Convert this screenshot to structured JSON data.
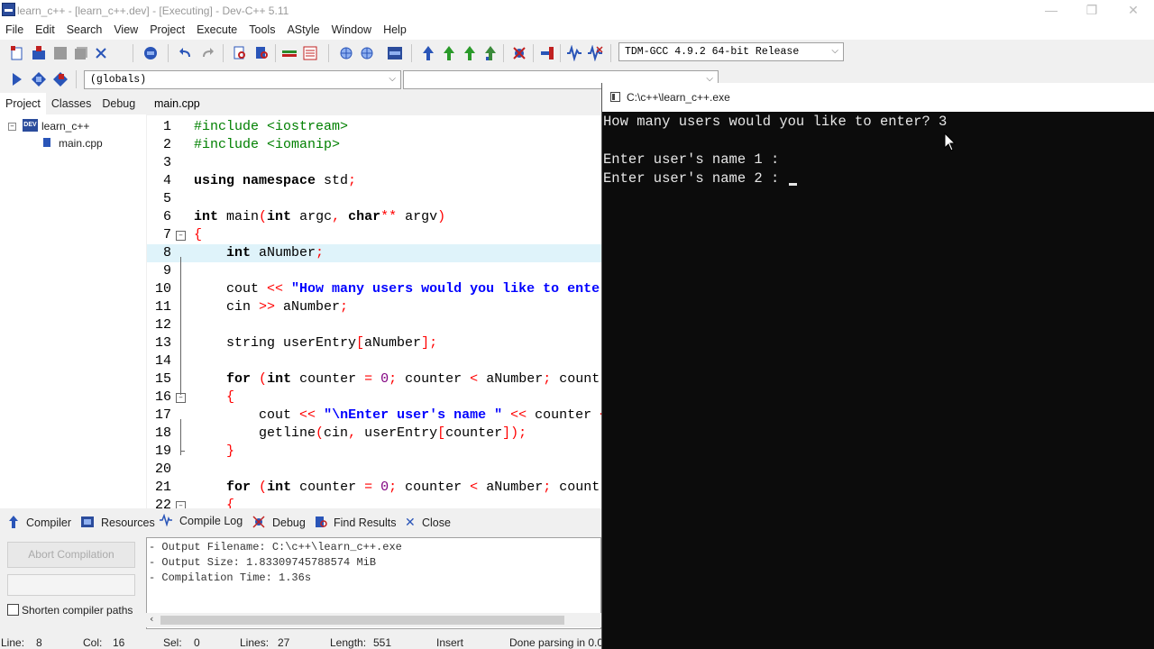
{
  "window": {
    "title": "learn_c++ - [learn_c++.dev] - [Executing] - Dev-C++ 5.11",
    "controls": [
      "minimize-icon",
      "restore-icon",
      "close-icon"
    ]
  },
  "menu": [
    "File",
    "Edit",
    "Search",
    "View",
    "Project",
    "Execute",
    "Tools",
    "AStyle",
    "Window",
    "Help"
  ],
  "toolbar": {
    "compiler_select": "TDM-GCC 4.9.2 64-bit Release",
    "scope_select": "(globals)",
    "member_select": ""
  },
  "left_panel": {
    "tabs": [
      "Project",
      "Classes",
      "Debug"
    ],
    "tree": {
      "project": "learn_c++",
      "project_badge": "DEV",
      "file": "main.cpp"
    }
  },
  "editor": {
    "tab": "main.cpp",
    "lines": [
      {
        "n": "1",
        "segs": [
          {
            "c": "pre",
            "t": "#include <iostream>"
          }
        ]
      },
      {
        "n": "2",
        "segs": [
          {
            "c": "pre",
            "t": "#include <iomanip>"
          }
        ]
      },
      {
        "n": "3",
        "segs": []
      },
      {
        "n": "4",
        "segs": [
          {
            "c": "kw",
            "t": "using namespace"
          },
          {
            "c": "",
            "t": " std"
          },
          {
            "c": "sym",
            "t": ";"
          }
        ]
      },
      {
        "n": "5",
        "segs": []
      },
      {
        "n": "6",
        "segs": [
          {
            "c": "kw",
            "t": "int"
          },
          {
            "c": "",
            "t": " main"
          },
          {
            "c": "sym",
            "t": "("
          },
          {
            "c": "kw",
            "t": "int"
          },
          {
            "c": "",
            "t": " argc"
          },
          {
            "c": "sym",
            "t": ","
          },
          {
            "c": "",
            "t": " "
          },
          {
            "c": "kw",
            "t": "char"
          },
          {
            "c": "sym",
            "t": "**"
          },
          {
            "c": "",
            "t": " argv"
          },
          {
            "c": "sym",
            "t": ")"
          }
        ]
      },
      {
        "n": "7",
        "segs": [
          {
            "c": "sym",
            "t": "{"
          }
        ]
      },
      {
        "n": "8",
        "segs": [
          {
            "c": "",
            "t": "    "
          },
          {
            "c": "kw",
            "t": "int"
          },
          {
            "c": "",
            "t": " aNumber"
          },
          {
            "c": "sym",
            "t": ";"
          }
        ]
      },
      {
        "n": "9",
        "segs": []
      },
      {
        "n": "10",
        "segs": [
          {
            "c": "",
            "t": "    cout "
          },
          {
            "c": "sym",
            "t": "<<"
          },
          {
            "c": "",
            "t": " "
          },
          {
            "c": "str",
            "t": "\"How many users would you like to ente"
          }
        ]
      },
      {
        "n": "11",
        "segs": [
          {
            "c": "",
            "t": "    cin "
          },
          {
            "c": "sym",
            "t": ">>"
          },
          {
            "c": "",
            "t": " aNumber"
          },
          {
            "c": "sym",
            "t": ";"
          }
        ]
      },
      {
        "n": "12",
        "segs": []
      },
      {
        "n": "13",
        "segs": [
          {
            "c": "",
            "t": "    string userEntry"
          },
          {
            "c": "sym",
            "t": "["
          },
          {
            "c": "",
            "t": "aNumber"
          },
          {
            "c": "sym",
            "t": "];"
          }
        ]
      },
      {
        "n": "14",
        "segs": []
      },
      {
        "n": "15",
        "segs": [
          {
            "c": "",
            "t": "    "
          },
          {
            "c": "kw",
            "t": "for"
          },
          {
            "c": "",
            "t": " "
          },
          {
            "c": "sym",
            "t": "("
          },
          {
            "c": "kw",
            "t": "int"
          },
          {
            "c": "",
            "t": " counter "
          },
          {
            "c": "sym",
            "t": "="
          },
          {
            "c": "",
            "t": " "
          },
          {
            "c": "num",
            "t": "0"
          },
          {
            "c": "sym",
            "t": ";"
          },
          {
            "c": "",
            "t": " counter "
          },
          {
            "c": "sym",
            "t": "<"
          },
          {
            "c": "",
            "t": " aNumber"
          },
          {
            "c": "sym",
            "t": ";"
          },
          {
            "c": "",
            "t": " count"
          }
        ]
      },
      {
        "n": "16",
        "segs": [
          {
            "c": "",
            "t": "    "
          },
          {
            "c": "sym",
            "t": "{"
          }
        ]
      },
      {
        "n": "17",
        "segs": [
          {
            "c": "",
            "t": "        cout "
          },
          {
            "c": "sym",
            "t": "<<"
          },
          {
            "c": "",
            "t": " "
          },
          {
            "c": "str",
            "t": "\"\\nEnter user's name \""
          },
          {
            "c": "",
            "t": " "
          },
          {
            "c": "sym",
            "t": "<<"
          },
          {
            "c": "",
            "t": " counter "
          },
          {
            "c": "sym",
            "t": "<"
          }
        ]
      },
      {
        "n": "18",
        "segs": [
          {
            "c": "",
            "t": "        getline"
          },
          {
            "c": "sym",
            "t": "("
          },
          {
            "c": "",
            "t": "cin"
          },
          {
            "c": "sym",
            "t": ","
          },
          {
            "c": "",
            "t": " userEntry"
          },
          {
            "c": "sym",
            "t": "["
          },
          {
            "c": "",
            "t": "counter"
          },
          {
            "c": "sym",
            "t": "]);"
          }
        ]
      },
      {
        "n": "19",
        "segs": [
          {
            "c": "",
            "t": "    "
          },
          {
            "c": "sym",
            "t": "}"
          }
        ]
      },
      {
        "n": "20",
        "segs": []
      },
      {
        "n": "21",
        "segs": [
          {
            "c": "",
            "t": "    "
          },
          {
            "c": "kw",
            "t": "for"
          },
          {
            "c": "",
            "t": " "
          },
          {
            "c": "sym",
            "t": "("
          },
          {
            "c": "kw",
            "t": "int"
          },
          {
            "c": "",
            "t": " counter "
          },
          {
            "c": "sym",
            "t": "="
          },
          {
            "c": "",
            "t": " "
          },
          {
            "c": "num",
            "t": "0"
          },
          {
            "c": "sym",
            "t": ";"
          },
          {
            "c": "",
            "t": " counter "
          },
          {
            "c": "sym",
            "t": "<"
          },
          {
            "c": "",
            "t": " aNumber"
          },
          {
            "c": "sym",
            "t": ";"
          },
          {
            "c": "",
            "t": " count"
          }
        ]
      },
      {
        "n": "22",
        "segs": [
          {
            "c": "",
            "t": "    "
          },
          {
            "c": "sym",
            "t": "{"
          }
        ]
      }
    ]
  },
  "bottom_tabs": [
    "Compiler",
    "Resources",
    "Compile Log",
    "Debug",
    "Find Results",
    "Close"
  ],
  "compile_log": {
    "abort_button": "Abort Compilation",
    "shorten_paths_label": "Shorten compiler paths",
    "lines": [
      "- Output Filename: C:\\c++\\learn_c++.exe",
      "- Output Size: 1.83309745788574 MiB",
      "- Compilation Time: 1.36s"
    ]
  },
  "status": {
    "line_label": "Line:",
    "line_value": "8",
    "col_label": "Col:",
    "col_value": "16",
    "sel_label": "Sel:",
    "sel_value": "0",
    "lines_label": "Lines:",
    "lines_value": "27",
    "length_label": "Length:",
    "length_value": "551",
    "mode": "Insert",
    "message": "Done parsing in 0.0"
  },
  "console": {
    "title": "C:\\c++\\learn_c++.exe",
    "lines": [
      "How many users would you like to enter? 3",
      "",
      "Enter user's name 1 :",
      "Enter user's name 2 : "
    ]
  }
}
